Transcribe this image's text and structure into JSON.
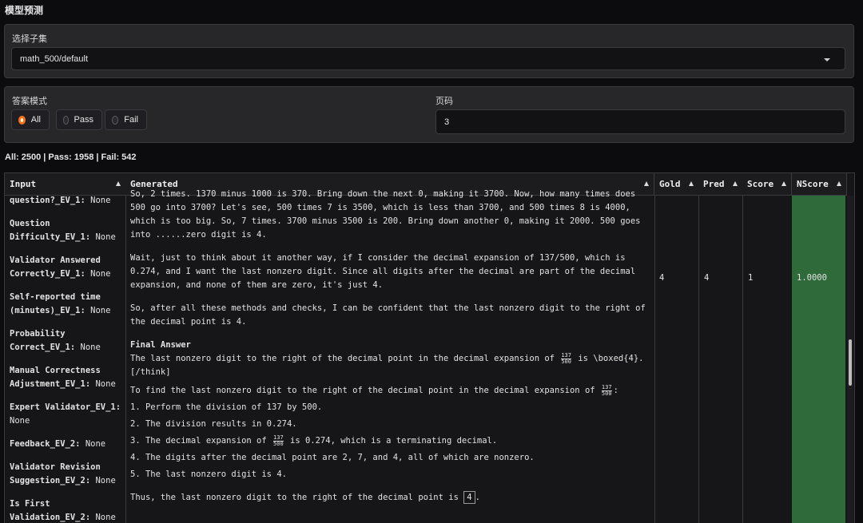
{
  "page": {
    "title": "模型预测"
  },
  "subset": {
    "label": "选择子集",
    "value": "math_500/default"
  },
  "mode": {
    "label": "答案模式",
    "options": [
      "All",
      "Pass",
      "Fail"
    ],
    "selected": "All"
  },
  "page_number": {
    "label": "页码",
    "value": "3"
  },
  "summary": "All: 2500 | Pass: 1958 | Fail: 542",
  "table": {
    "headers": [
      "Input",
      "Generated",
      "Gold",
      "Pred",
      "Score",
      "NScore"
    ],
    "input_items": [
      {
        "key": "question?_EV_1:",
        "value": "None"
      },
      {
        "key": "Question Difficulty_EV_1:",
        "value": "None"
      },
      {
        "key": "Validator Answered Correctly_EV_1:",
        "value": "None"
      },
      {
        "key": "Self-reported time (minutes)_EV_1:",
        "value": "None"
      },
      {
        "key": "Probability Correct_EV_1:",
        "value": "None"
      },
      {
        "key": "Manual Correctness Adjustment_EV_1:",
        "value": "None"
      },
      {
        "key": "Expert Validator_EV_1:",
        "value": "None"
      },
      {
        "key": "Feedback_EV_2:",
        "value": "None"
      },
      {
        "key": "Validator Revision Suggestion_EV_2:",
        "value": "None"
      },
      {
        "key": "Is First Validation_EV_2:",
        "value": "None"
      }
    ],
    "generated": {
      "p1": "So, 2 times. 1370 minus 1000 is 370. Bring down the next 0, making it 3700. Now, how many times does 500 go into 3700? Let's see, 500 times 7 is 3500, which is less than 3700, and 500 times 8 is 4000, which is too big. So, 7 times. 3700 minus 3500 is 200. Bring down another 0, making it 2000. 500 goes into ......zero digit is 4.",
      "p2": "Wait, just to think about it another way, if I consider the decimal expansion of 137/500, which is 0.274, and I want the last nonzero digit. Since all digits after the decimal are part of the decimal expansion, and none of them are zero, it's just 4.",
      "p3": "So, after all these methods and checks, I can be confident that the last nonzero digit to the right of the decimal point is 4.",
      "final_heading": "Final Answer",
      "final_a": "The last nonzero digit to the right of the decimal point in the decimal expansion of",
      "final_b": "is \\boxed{4}.",
      "final_c": "[/think]",
      "intro": "To find the last nonzero digit to the right of the decimal point in the decimal expansion of",
      "intro_end": ":",
      "step1": "1. Perform the division of 137 by 500.",
      "step2": "2. The division results in 0.274.",
      "step3a": "3. The decimal expansion of",
      "step3b": "is 0.274, which is a terminating decimal.",
      "step4": "4. The digits after the decimal point are 2, 7, and 4, all of which are nonzero.",
      "step5": "5. The last nonzero digit is 4.",
      "thus": "Thus, the last nonzero digit to the right of the decimal point is",
      "boxed": "4",
      "frac_num": "137",
      "frac_den": "500"
    },
    "gold": "4",
    "pred": "4",
    "score": "1",
    "nscore": "1.0000"
  },
  "colors": {
    "accent": "#f97316",
    "nscore_bg": "#2f6b3a"
  }
}
